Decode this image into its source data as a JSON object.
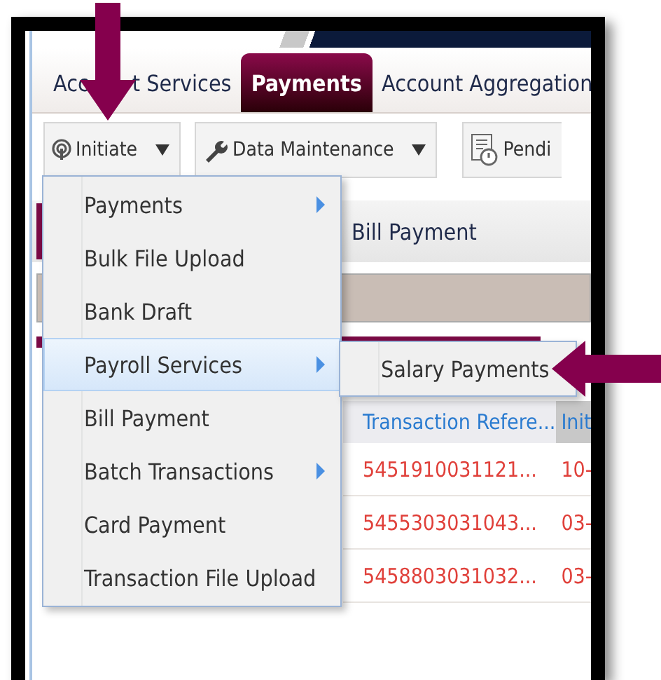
{
  "tabs": [
    {
      "prefix": "Acc",
      "label": "t Services",
      "selected": false
    },
    {
      "label": "Payments",
      "selected": true
    },
    {
      "label": "Account Aggregation",
      "selected": false
    }
  ],
  "toolbar": [
    {
      "kind": "initiate",
      "label": "Initiate",
      "dropdown": true
    },
    {
      "kind": "maintenance",
      "label": "Data Maintenance",
      "dropdown": true
    },
    {
      "kind": "pending",
      "label": "Pendi",
      "dropdown": false
    }
  ],
  "subtab": "Bill Payment",
  "table": {
    "columns": [
      "Transaction Refere...",
      "Init"
    ],
    "rows": [
      [
        "5451910031121...",
        "10-"
      ],
      [
        "5455303031043...",
        "03-"
      ],
      [
        "5458803031032...",
        "03-"
      ]
    ]
  },
  "menu": [
    {
      "label": "Payments",
      "submenu": true,
      "selected": false
    },
    {
      "label": "Bulk File Upload",
      "submenu": false,
      "selected": false
    },
    {
      "label": "Bank Draft",
      "submenu": false,
      "selected": false
    },
    {
      "label": "Payroll Services",
      "submenu": true,
      "selected": true
    },
    {
      "label": "Bill Payment",
      "submenu": false,
      "selected": false
    },
    {
      "label": "Batch Transactions",
      "submenu": true,
      "selected": false
    },
    {
      "label": "Card Payment",
      "submenu": false,
      "selected": false
    },
    {
      "label": "Transaction File Upload",
      "submenu": false,
      "selected": false
    }
  ],
  "submenu": [
    {
      "label": "Salary Payments",
      "selected": false
    }
  ]
}
